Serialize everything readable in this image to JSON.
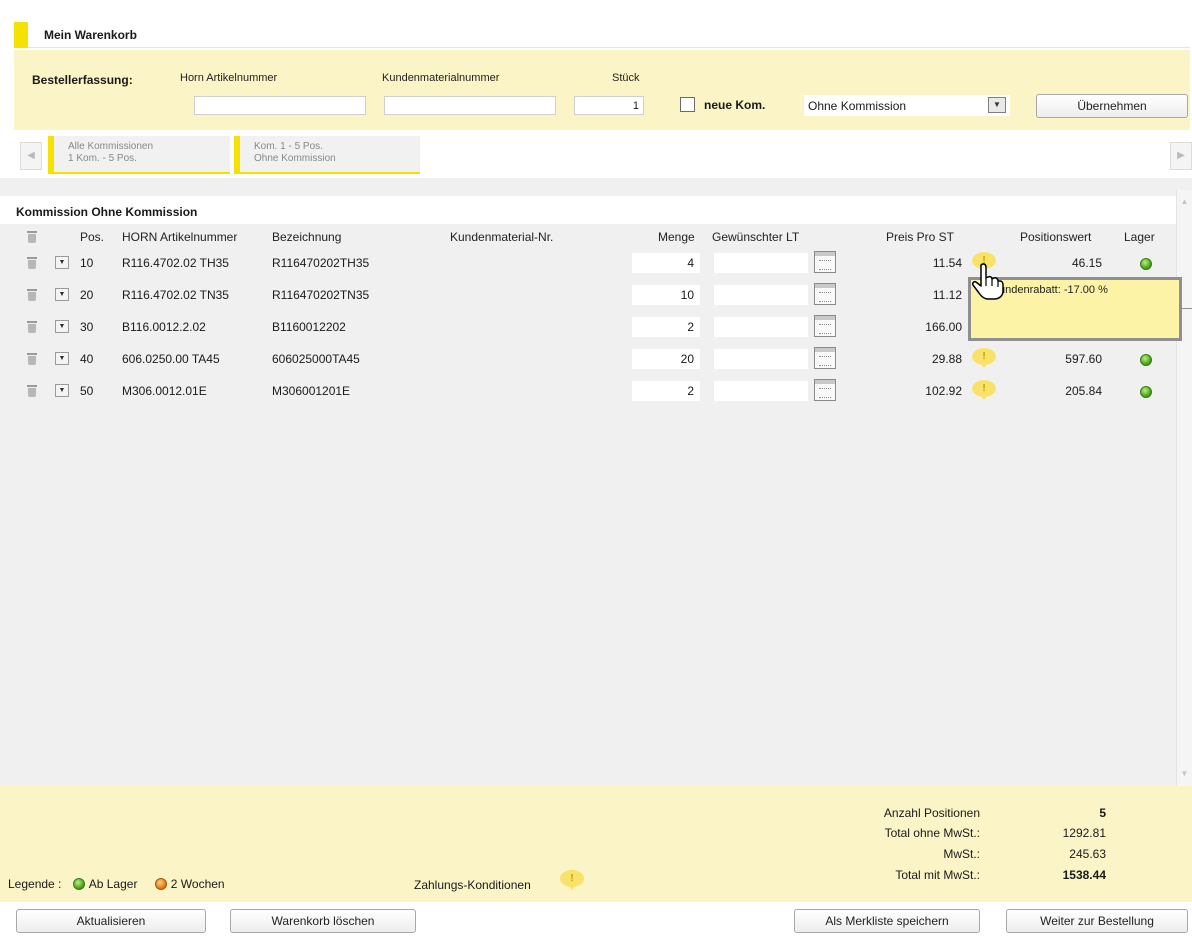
{
  "header": {
    "title": "Mein Warenkorb"
  },
  "order_entry": {
    "label": "Bestellerfassung:",
    "col_article": "Horn Artikelnummer",
    "col_customer_material": "Kundenmaterialnummer",
    "col_qty": "Stück",
    "article_value": "",
    "customer_material_value": "",
    "qty_value": "1",
    "new_commission_label": "neue Kom.",
    "commission_select": "Ohne Kommission",
    "apply_button": "Übernehmen"
  },
  "commission_tabs": [
    {
      "line1": "Alle Kommissionen",
      "line2": "1 Kom. - 5 Pos."
    },
    {
      "line1": "Kom. 1 - 5 Pos.",
      "line2": "Ohne Kommission"
    }
  ],
  "section": {
    "title": "Kommission Ohne Kommission"
  },
  "columns": {
    "pos": "Pos.",
    "article": "HORN Artikelnummer",
    "description": "Bezeichnung",
    "customer_material": "Kundenmaterial-Nr.",
    "qty": "Menge",
    "desired_date": "Gewünschter LT",
    "unit_price": "Preis Pro ST",
    "position_value": "Positionswert",
    "stock": "Lager"
  },
  "rows": [
    {
      "pos": "10",
      "article": "R116.4702.02 TH35",
      "description": "R116470202TH35",
      "customer_material": "",
      "qty": "4",
      "price": "11.54",
      "value": "46.15",
      "stock": "green"
    },
    {
      "pos": "20",
      "article": "R116.4702.02 TN35",
      "description": "R116470202TN35",
      "customer_material": "",
      "qty": "10",
      "price": "11.12",
      "value": "",
      "stock": "green"
    },
    {
      "pos": "30",
      "article": "B116.0012.2.02",
      "description": "B1160012202",
      "customer_material": "",
      "qty": "2",
      "price": "166.00",
      "value": "",
      "stock": "green"
    },
    {
      "pos": "40",
      "article": "606.0250.00 TA45",
      "description": "606025000TA45",
      "customer_material": "",
      "qty": "20",
      "price": "29.88",
      "value": "597.60",
      "stock": "green"
    },
    {
      "pos": "50",
      "article": "M306.0012.01E",
      "description": "M306001201E",
      "customer_material": "",
      "qty": "2",
      "price": "102.92",
      "value": "205.84",
      "stock": "green"
    }
  ],
  "tooltip": {
    "text": "undenrabatt: -17.00 %"
  },
  "summary": {
    "count_label": "Anzahl Positionen",
    "count_value": "5",
    "net_label": "Total ohne MwSt.:",
    "net_value": "1292.81",
    "vat_label": "MwSt.:",
    "vat_value": "245.63",
    "gross_label": "Total mit MwSt.:",
    "gross_value": "1538.44"
  },
  "legend": {
    "label": "Legende :",
    "in_stock": "Ab Lager",
    "two_weeks": "2 Wochen",
    "payment_terms": "Zahlungs-Konditionen"
  },
  "buttons": {
    "refresh": "Aktualisieren",
    "clear_cart": "Warenkorb löschen",
    "save_wishlist": "Als Merkliste speichern",
    "continue": "Weiter zur Bestellung"
  },
  "icons": {
    "note": "speech-bubble-icon",
    "stock_ok": "green-dot-icon",
    "stock_delay": "orange-dot-icon",
    "delete": "trash-icon",
    "calendar": "calendar-icon"
  },
  "colors": {
    "accent_yellow": "#f6e200",
    "panel_yellow": "#fbf4c6",
    "grid_gray": "#f0f0f0",
    "stock_green": "#3f9a12",
    "stock_orange": "#e2720a"
  }
}
